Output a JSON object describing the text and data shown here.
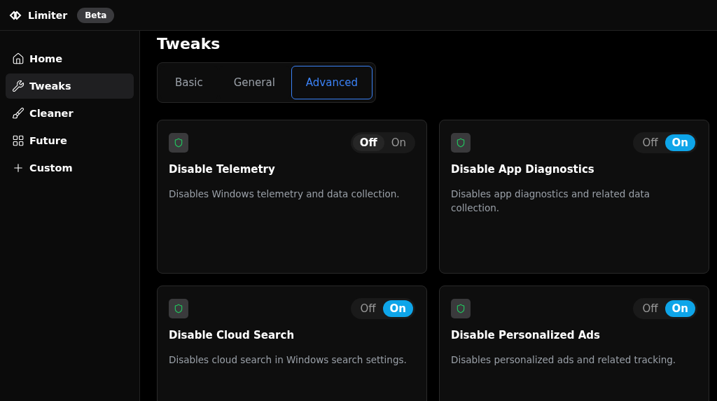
{
  "app": {
    "name": "Limiter",
    "badge": "Beta"
  },
  "sidebar": {
    "items": [
      {
        "label": "Home",
        "selected": false
      },
      {
        "label": "Tweaks",
        "selected": true
      },
      {
        "label": "Cleaner",
        "selected": false
      },
      {
        "label": "Future",
        "selected": false
      },
      {
        "label": "Custom",
        "selected": false
      }
    ]
  },
  "page_title": "Tweaks",
  "tabs": [
    {
      "label": "Basic",
      "selected": false
    },
    {
      "label": "General",
      "selected": false
    },
    {
      "label": "Advanced",
      "selected": true
    }
  ],
  "cards": [
    {
      "title": "Disable Telemetry",
      "description": "Disables Windows telemetry and data collection.",
      "off_label": "Off",
      "on_label": "On",
      "on": false
    },
    {
      "title": "Disable App Diagnostics",
      "description": "Disables app diagnostics and related data collection.",
      "off_label": "Off",
      "on_label": "On",
      "on": true
    },
    {
      "title": "Disable Cloud Search",
      "description": "Disables cloud search in Windows search settings.",
      "off_label": "Off",
      "on_label": "On",
      "on": true
    },
    {
      "title": "Disable Personalized Ads",
      "description": "Disables personalized ads and related tracking.",
      "off_label": "Off",
      "on_label": "On",
      "on": true
    }
  ]
}
